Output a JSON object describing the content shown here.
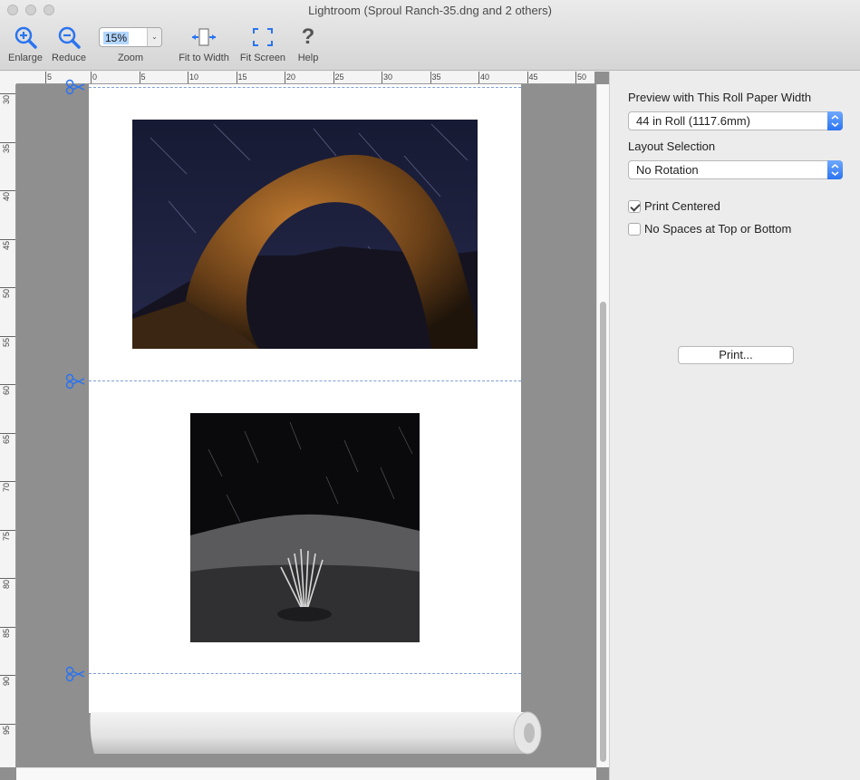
{
  "window": {
    "title": "Lightroom (Sproul Ranch-35.dng and 2 others)"
  },
  "toolbar": {
    "enlarge_label": "Enlarge",
    "reduce_label": "Reduce",
    "zoom_label": "Zoom",
    "zoom_value": "15%",
    "fit_width_label": "Fit to Width",
    "fit_screen_label": "Fit Screen",
    "help_label": "Help"
  },
  "rulers": {
    "top": [
      "5",
      "0",
      "5",
      "10",
      "15",
      "20",
      "25",
      "30",
      "35",
      "40",
      "45",
      "50"
    ],
    "left": [
      "30",
      "35",
      "40",
      "45",
      "50",
      "55",
      "60",
      "65",
      "70",
      "75",
      "80",
      "85",
      "90",
      "95"
    ]
  },
  "panel": {
    "roll_width_label": "Preview with This Roll Paper Width",
    "roll_width_value": "44 in Roll (1117.6mm)",
    "layout_label": "Layout Selection",
    "layout_value": "No Rotation",
    "print_centered_label": "Print Centered",
    "print_centered_checked": true,
    "no_spaces_label": "No Spaces at Top or Bottom",
    "no_spaces_checked": false,
    "print_button": "Print..."
  },
  "colors": {
    "accent": "#2b74f0",
    "cutline": "#7f9fd6"
  }
}
